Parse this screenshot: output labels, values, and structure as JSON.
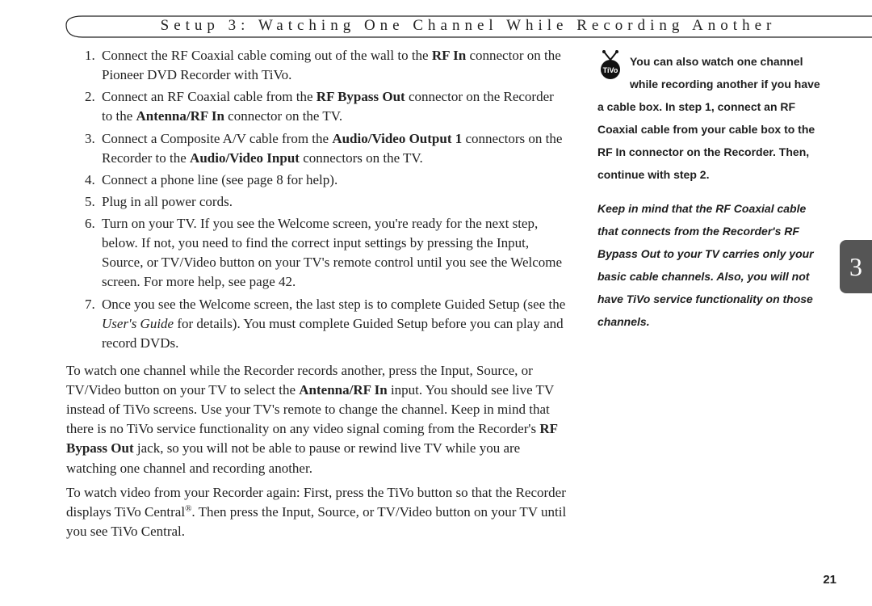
{
  "header": {
    "title": "Setup 3: Watching One Channel While Recording Another"
  },
  "steps": {
    "s1a": "Connect the RF Coaxial cable coming out of the wall to the ",
    "s1b": "RF In",
    "s1c": " connector on the Pioneer DVD Recorder with TiVo.",
    "s2a": "Connect an RF Coaxial cable from the ",
    "s2b": "RF Bypass Out",
    "s2c": " connector on the Recorder to the ",
    "s2d": "Antenna/RF In",
    "s2e": " connector on the TV.",
    "s3a": "Connect a Composite A/V cable from the ",
    "s3b": "Audio/Video Output 1",
    "s3c": " connectors on the Recorder to the ",
    "s3d": "Audio/Video Input",
    "s3e": " connectors on the TV.",
    "s4": "Connect a phone line (see page 8 for help).",
    "s5": "Plug in all power cords.",
    "s6": "Turn on your TV. If you see the Welcome screen, you're ready for the next step, below. If not, you need to find the correct input settings by pressing the Input, Source, or TV/Video button on your TV's remote control until you see the Welcome screen. For more help, see page 42.",
    "s7a": "Once you see the Welcome screen, the last step is to complete Guided Setup (see the ",
    "s7b": "User's Guide",
    "s7c": " for details). You must complete Guided Setup before you can play and record DVDs."
  },
  "para1": {
    "a": "To watch one channel while the Recorder records another, press the Input, Source, or TV/Video button on your TV to select the ",
    "b": "Antenna/RF In",
    "c": " input. You should see live TV instead of TiVo screens. Use your TV's remote to change the channel. Keep in mind that there is no TiVo service functionality on any video signal coming from the Recorder's ",
    "d": "RF Bypass Out",
    "e": " jack, so you will not be able to pause or rewind live TV while you are watching one channel and recording another."
  },
  "para2": {
    "a": "To watch video from your Recorder again: First, press the TiVo button so that the Recorder displays TiVo Central",
    "b": ". Then press the Input, Source, or TV/Video button on your TV until you see TiVo Central."
  },
  "sidebar": {
    "p1": "You can also watch one channel while recording another if you have a cable box. In step 1, connect an RF Coaxial cable from your cable box to the RF In connector on the Recorder. Then, continue with step 2.",
    "p2": "Keep in mind that the RF Coaxial cable that connects from the Recorder's RF Bypass Out to your TV carries only your basic cable channels. Also, you will not have TiVo service functionality on those channels."
  },
  "tab": "3",
  "pagenum": "21"
}
